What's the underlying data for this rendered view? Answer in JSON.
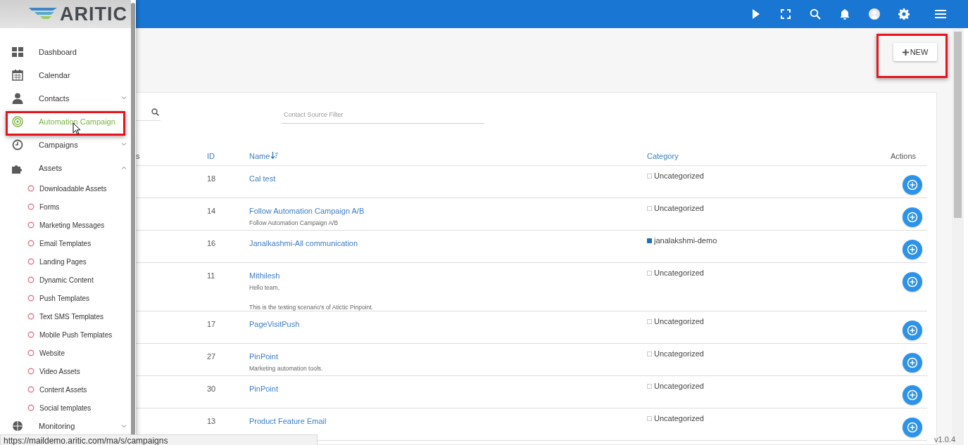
{
  "sidebar": {
    "logo": "ARITIC",
    "items": [
      {
        "label": "Dashboard",
        "selected": false
      },
      {
        "label": "Calendar",
        "selected": false
      },
      {
        "label": "Contacts",
        "selected": false,
        "expanded": false
      },
      {
        "label": "Automation Campaign",
        "selected": true,
        "highlighted": true
      },
      {
        "label": "Campaigns",
        "selected": false,
        "expanded": false
      },
      {
        "label": "Assets",
        "selected": false,
        "expanded": true,
        "children": [
          {
            "label": "Downloadable Assets"
          },
          {
            "label": "Forms"
          },
          {
            "label": "Marketing Messages"
          },
          {
            "label": "Email Templates"
          },
          {
            "label": "Landing Pages"
          },
          {
            "label": "Dynamic Content"
          },
          {
            "label": "Push Templates"
          },
          {
            "label": "Text SMS Templates"
          },
          {
            "label": "Mobile Push Templates"
          },
          {
            "label": "Website"
          },
          {
            "label": "Video Assets"
          },
          {
            "label": "Content Assets"
          },
          {
            "label": "Social templates"
          }
        ]
      },
      {
        "label": "Monitoring",
        "selected": false,
        "expanded": false
      }
    ]
  },
  "new_button": {
    "label": "NEW",
    "highlighted": true
  },
  "filters": {
    "contact_source": {
      "placeholder": "Contact Source Filter"
    }
  },
  "table": {
    "columns": [
      {
        "label": "s",
        "sortable": false
      },
      {
        "label": "ID",
        "sortable": true
      },
      {
        "label": "Name",
        "sortable": true,
        "sorted": true
      },
      {
        "label": "Category",
        "sortable": true
      },
      {
        "label": "Actions",
        "sortable": false
      }
    ],
    "rows": [
      {
        "id": "18",
        "name": "Cal test",
        "category": "Uncategorized"
      },
      {
        "id": "14",
        "name": "Follow Automation Campaign A/B",
        "description": [
          "Follow Automation Campaign A/B"
        ],
        "category": "Uncategorized"
      },
      {
        "id": "16",
        "name": "Janalkashmi-All communication",
        "category": "janalakshmi-demo",
        "color": "#1e6fc0"
      },
      {
        "id": "11",
        "name": "Mithilesh",
        "description": [
          "Hello team,",
          "This is the testing scenario's of Atictic Pinpoint."
        ],
        "category": "Uncategorized"
      },
      {
        "id": "17",
        "name": "PageVisitPush",
        "category": "Uncategorized"
      },
      {
        "id": "27",
        "name": "PinPoint",
        "description": [
          "Marketing automation tools."
        ],
        "category": "Uncategorized"
      },
      {
        "id": "30",
        "name": "PinPoint",
        "category": "Uncategorized"
      },
      {
        "id": "13",
        "name": "Product Feature Email",
        "category": "Uncategorized"
      }
    ]
  },
  "status_url": "https://maildemo.aritic.com/ma/s/campaigns",
  "version": "v1.0.4"
}
